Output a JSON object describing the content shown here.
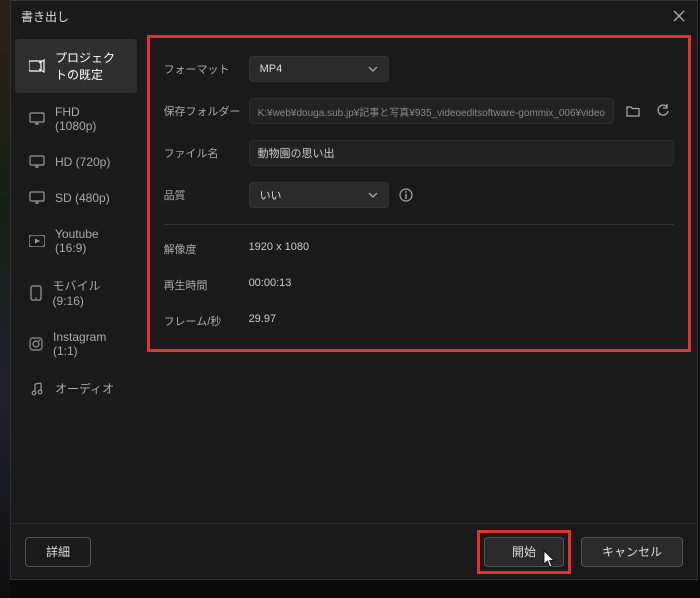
{
  "window": {
    "title": "書き出し"
  },
  "sidebar": {
    "items": [
      {
        "label": "プロジェクトの既定"
      },
      {
        "label": "FHD (1080p)"
      },
      {
        "label": "HD (720p)"
      },
      {
        "label": "SD (480p)"
      },
      {
        "label": "Youtube (16:9)"
      },
      {
        "label": "モバイル (9:16)"
      },
      {
        "label": "Instagram (1:1)"
      },
      {
        "label": "オーディオ"
      }
    ]
  },
  "form": {
    "format_label": "フォーマット",
    "format_value": "MP4",
    "folder_label": "保存フォルダー",
    "folder_value": "K:¥web¥douga.sub.jp¥記事と写真¥935_videoeditsoftware-gommix_006¥video",
    "filename_label": "ファイル名",
    "filename_value": "動物園の思い出",
    "quality_label": "品質",
    "quality_value": "いい"
  },
  "metrics": {
    "resolution_label": "解像度",
    "resolution_value": "1920  x  1080",
    "duration_label": "再生時間",
    "duration_value": "00:00:13",
    "fps_label": "フレーム/秒",
    "fps_value": "29.97"
  },
  "footer": {
    "details": "詳細",
    "start": "開始",
    "cancel": "キャンセル"
  }
}
